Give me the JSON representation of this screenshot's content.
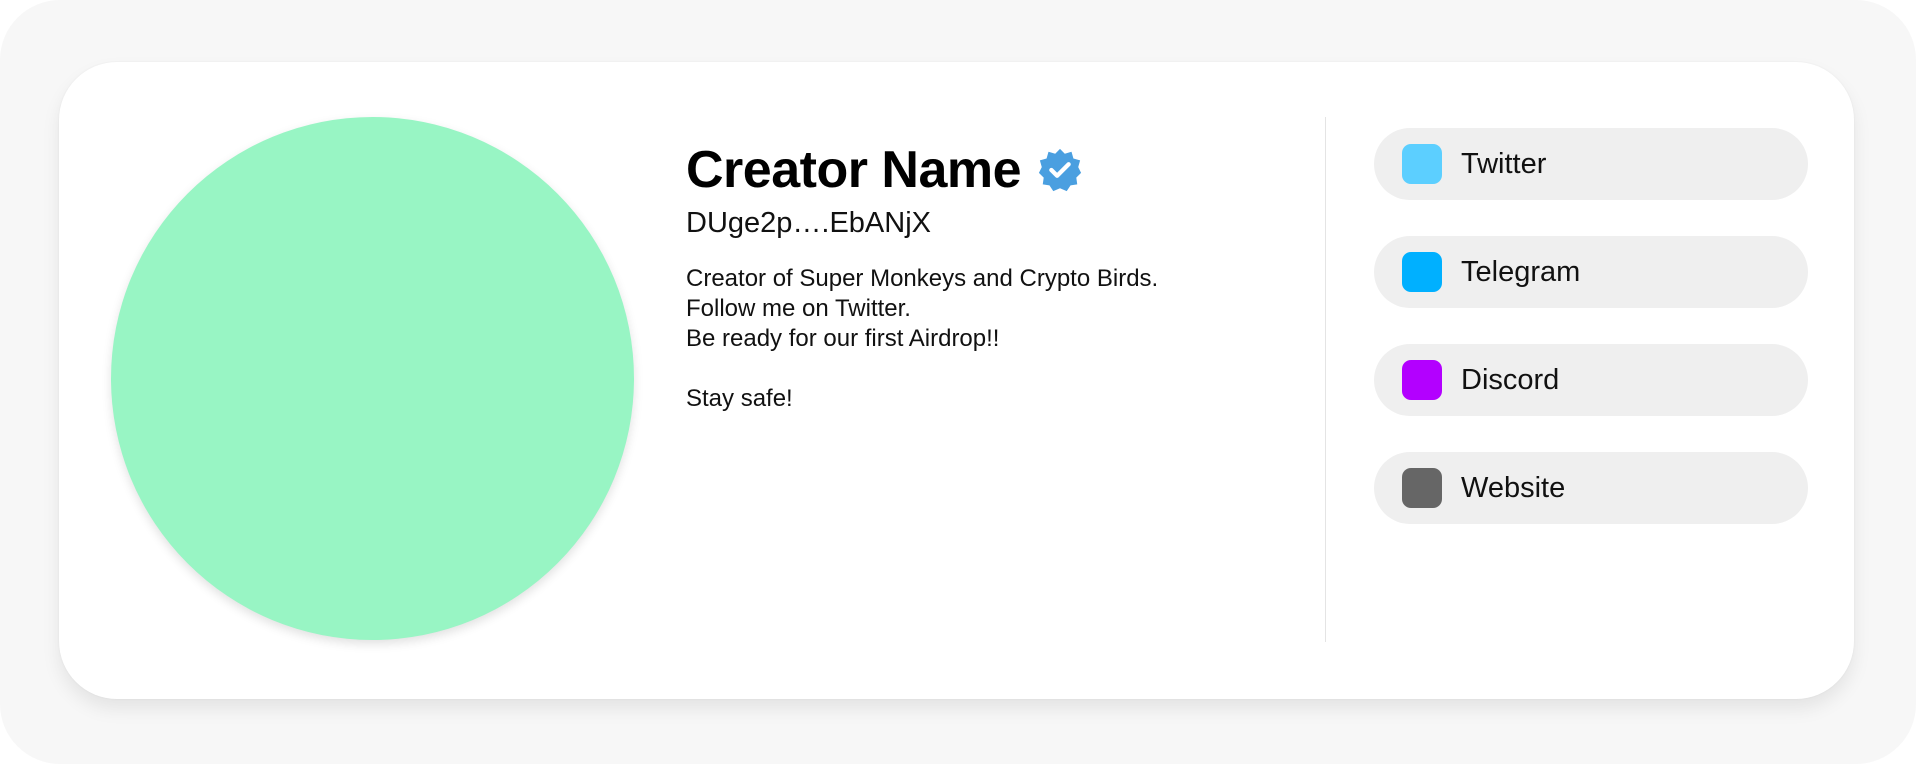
{
  "profile": {
    "name": "Creator Name",
    "verified_icon": "verified-badge-icon",
    "verified_color": "#4a9fe0",
    "address": "DUge2p….EbANjX",
    "avatar_color": "#98f5c4",
    "bio_lines": [
      "Creator of Super Monkeys and Crypto Birds.",
      "Follow me on Twitter.",
      "Be ready for our first Airdrop!!",
      "",
      "Stay safe!"
    ]
  },
  "links": [
    {
      "label": "Twitter",
      "icon": "twitter-icon",
      "color": "#5ccfff"
    },
    {
      "label": "Telegram",
      "icon": "telegram-icon",
      "color": "#00b0ff"
    },
    {
      "label": "Discord",
      "icon": "discord-icon",
      "color": "#b300ff"
    },
    {
      "label": "Website",
      "icon": "website-icon",
      "color": "#666666"
    }
  ]
}
